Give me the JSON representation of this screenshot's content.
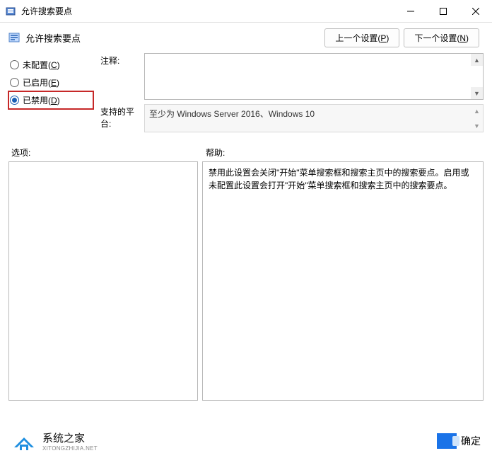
{
  "window": {
    "title": "允许搜索要点",
    "header_title": "允许搜索要点",
    "prev_button": "上一个设置(",
    "prev_key": "P",
    "prev_suffix": ")",
    "next_button": "下一个设置(",
    "next_key": "N",
    "next_suffix": ")"
  },
  "radio": {
    "not_configured": "未配置(",
    "not_configured_key": "C",
    "not_configured_suffix": ")",
    "enabled": "已启用(",
    "enabled_key": "E",
    "enabled_suffix": ")",
    "disabled": "已禁用(",
    "disabled_key": "D",
    "disabled_suffix": ")"
  },
  "labels": {
    "comment": "注释:",
    "platform": "支持的平台:",
    "options": "选项:",
    "help": "帮助:"
  },
  "platform_text": "至少为 Windows Server 2016、Windows 10",
  "help_text": "禁用此设置会关闭\"开始\"菜单搜索框和搜索主页中的搜索要点。启用或未配置此设置会打开\"开始\"菜单搜索框和搜索主页中的搜索要点。",
  "footer": {
    "brand_cn": "系统之家",
    "brand_en": "XITONGZHIJIA.NET",
    "ok": "确定"
  }
}
